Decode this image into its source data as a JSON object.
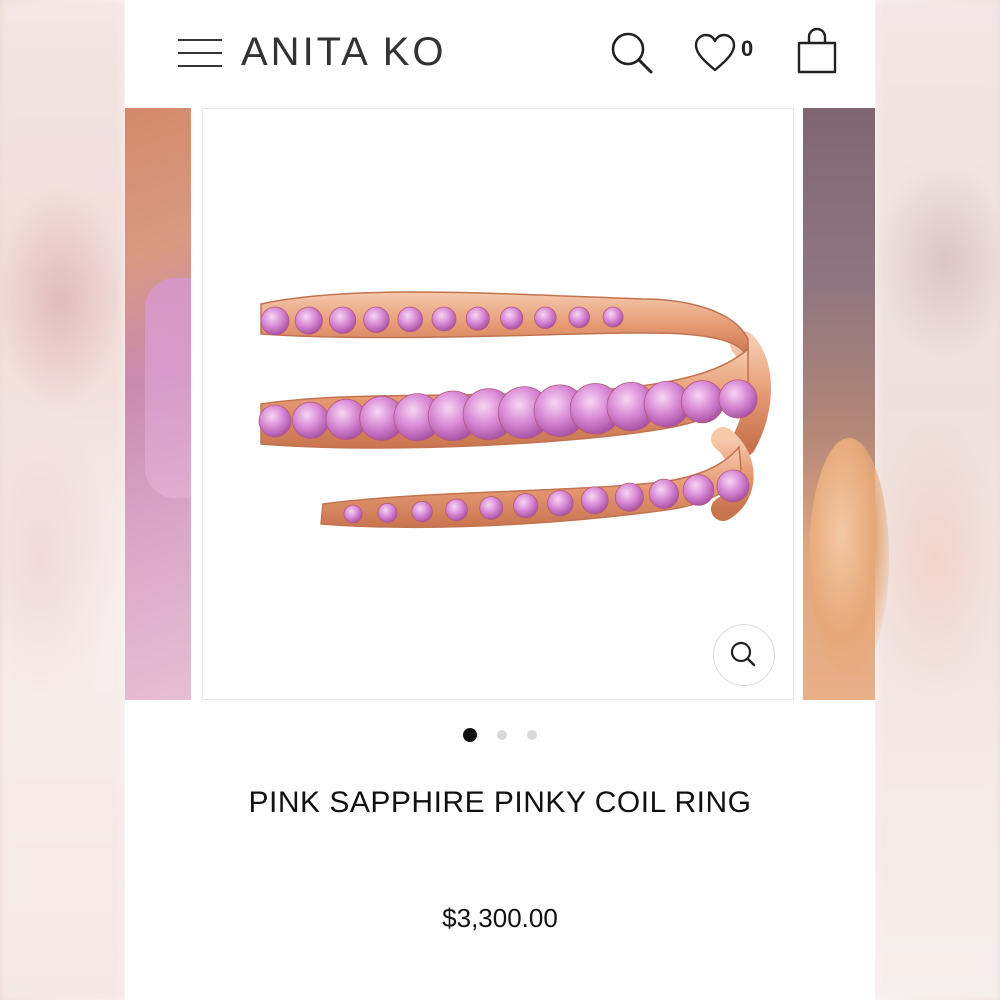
{
  "brand": {
    "name": "ANITA KO"
  },
  "header": {
    "menu_icon": "hamburger-menu-icon",
    "search_icon": "search-icon",
    "wishlist_icon": "heart-icon",
    "wishlist_count": "0",
    "cart_icon": "shopping-bag-icon"
  },
  "gallery": {
    "slide_count": 3,
    "active_slide": 1,
    "zoom_icon": "zoom-search-icon"
  },
  "product": {
    "title": "PINK SAPPHIRE PINKY COIL RING",
    "price": "$3,300.00"
  },
  "colors": {
    "text": "#111111",
    "metal": "#e8a27e",
    "stone": "#d98ad6",
    "active_dot": "#111111",
    "inactive_dot": "#d9d9d9"
  }
}
